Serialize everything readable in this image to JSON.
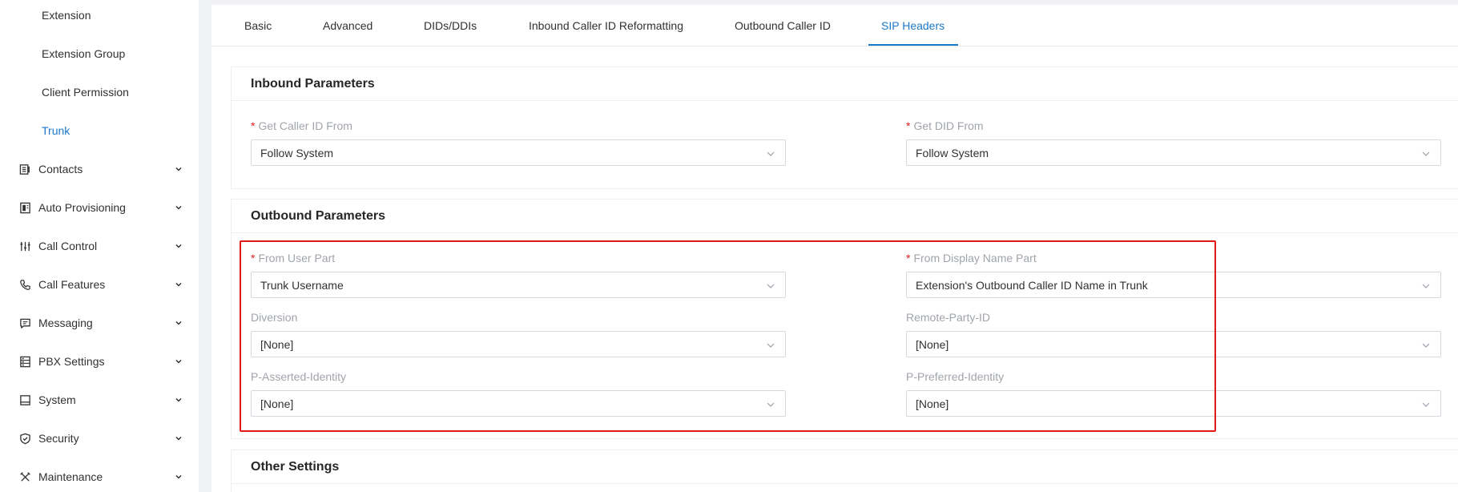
{
  "sidebar": {
    "sub_items": [
      {
        "label": "Extension"
      },
      {
        "label": "Extension Group"
      },
      {
        "label": "Client Permission"
      },
      {
        "label": "Trunk",
        "active": true
      }
    ],
    "menu": [
      {
        "label": "Contacts",
        "icon": "contacts-icon"
      },
      {
        "label": "Auto Provisioning",
        "icon": "provisioning-icon"
      },
      {
        "label": "Call Control",
        "icon": "call-control-icon"
      },
      {
        "label": "Call Features",
        "icon": "phone-icon"
      },
      {
        "label": "Messaging",
        "icon": "message-icon"
      },
      {
        "label": "PBX Settings",
        "icon": "pbx-settings-icon"
      },
      {
        "label": "System",
        "icon": "system-icon"
      },
      {
        "label": "Security",
        "icon": "shield-icon"
      },
      {
        "label": "Maintenance",
        "icon": "tools-icon"
      }
    ]
  },
  "tabs": [
    {
      "label": "Basic"
    },
    {
      "label": "Advanced"
    },
    {
      "label": "DIDs/DDIs"
    },
    {
      "label": "Inbound Caller ID Reformatting"
    },
    {
      "label": "Outbound Caller ID"
    },
    {
      "label": "SIP Headers",
      "active": true
    }
  ],
  "inbound": {
    "title": "Inbound Parameters",
    "get_caller_id_from": {
      "label": "Get Caller ID From",
      "value": "Follow System",
      "required": true
    },
    "get_did_from": {
      "label": "Get DID From",
      "value": "Follow System",
      "required": true
    }
  },
  "outbound": {
    "title": "Outbound Parameters",
    "from_user_part": {
      "label": "From User Part",
      "value": "Trunk Username",
      "required": true
    },
    "from_display_name_part": {
      "label": "From Display Name Part",
      "value": "Extension's Outbound Caller ID Name in Trunk",
      "required": true
    },
    "diversion": {
      "label": "Diversion",
      "value": "[None]"
    },
    "remote_party_id": {
      "label": "Remote-Party-ID",
      "value": "[None]"
    },
    "p_asserted_identity": {
      "label": "P-Asserted-Identity",
      "value": "[None]"
    },
    "p_preferred_identity": {
      "label": "P-Preferred-Identity",
      "value": "[None]"
    }
  },
  "other": {
    "title": "Other Settings"
  },
  "colors": {
    "accent": "#1e78c8",
    "required": "#e02020",
    "highlight_border": "#e01818"
  }
}
